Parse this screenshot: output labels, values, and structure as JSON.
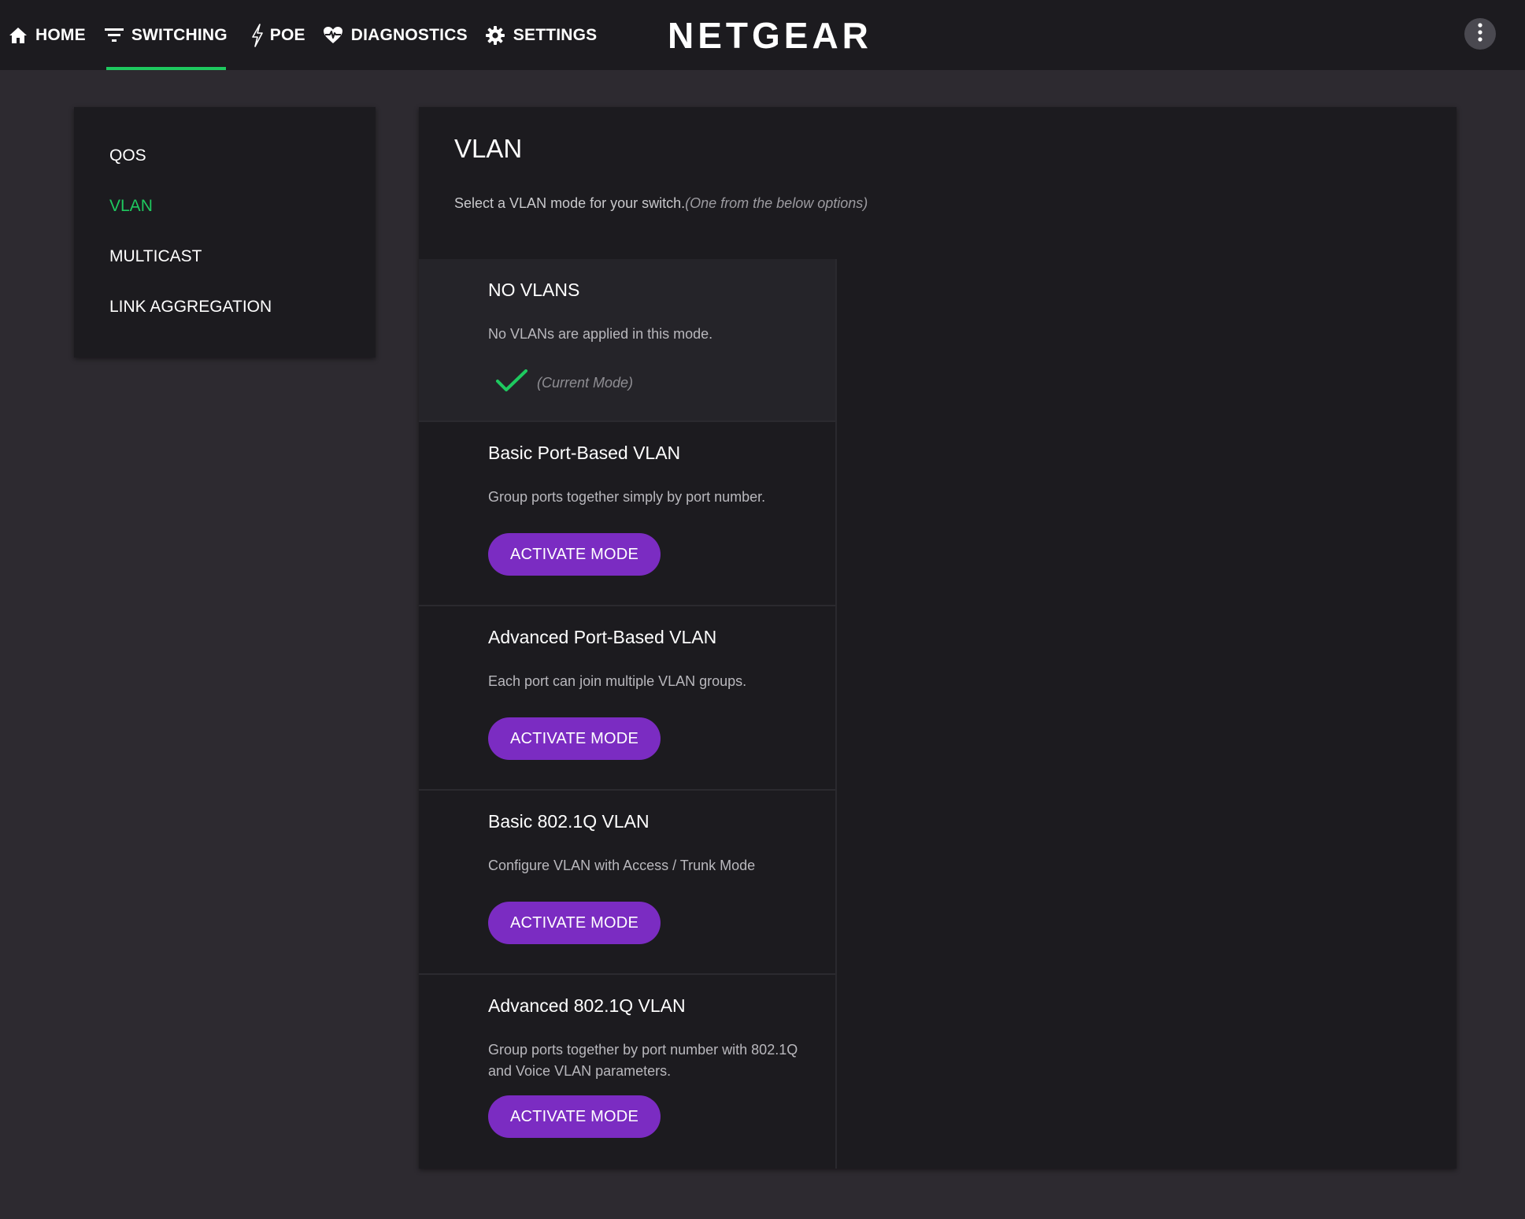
{
  "nav": {
    "items": [
      {
        "label": "HOME",
        "icon": "home-icon"
      },
      {
        "label": "SWITCHING",
        "icon": "filter-icon"
      },
      {
        "label": "POE",
        "icon": "bolt-icon"
      },
      {
        "label": "DIAGNOSTICS",
        "icon": "heart-pulse-icon"
      },
      {
        "label": "SETTINGS",
        "icon": "gear-icon"
      }
    ],
    "active": "SWITCHING",
    "brand": "NETGEAR",
    "more_icon": "more-vertical-icon"
  },
  "sidebar": {
    "items": [
      {
        "label": "QOS"
      },
      {
        "label": "VLAN"
      },
      {
        "label": "MULTICAST"
      },
      {
        "label": "LINK AGGREGATION"
      }
    ],
    "active": "VLAN"
  },
  "main": {
    "title": "VLAN",
    "subtitle": "Select a VLAN mode for your switch.",
    "subtitle_hint": "(One from the below options)",
    "modes": [
      {
        "title": "NO VLANS",
        "description": "No VLANs are applied in this mode.",
        "current": true,
        "current_label": "(Current Mode)"
      },
      {
        "title": "Basic Port-Based VLAN",
        "description": "Group ports together simply by port number.",
        "button": "ACTIVATE MODE"
      },
      {
        "title": "Advanced Port-Based VLAN",
        "description": "Each port can join multiple VLAN groups.",
        "button": "ACTIVATE MODE"
      },
      {
        "title": "Basic 802.1Q VLAN",
        "description": "Configure VLAN with Access / Trunk Mode",
        "button": "ACTIVATE MODE"
      },
      {
        "title": "Advanced 802.1Q VLAN",
        "description": "Group ports together by port number with 802.1Q and Voice VLAN parameters.",
        "button": "ACTIVATE MODE"
      }
    ]
  },
  "colors": {
    "accent_green": "#1ec95f",
    "button_purple": "#7b2cc2",
    "panel": "#1c1b1f",
    "background": "#2d2a30"
  }
}
